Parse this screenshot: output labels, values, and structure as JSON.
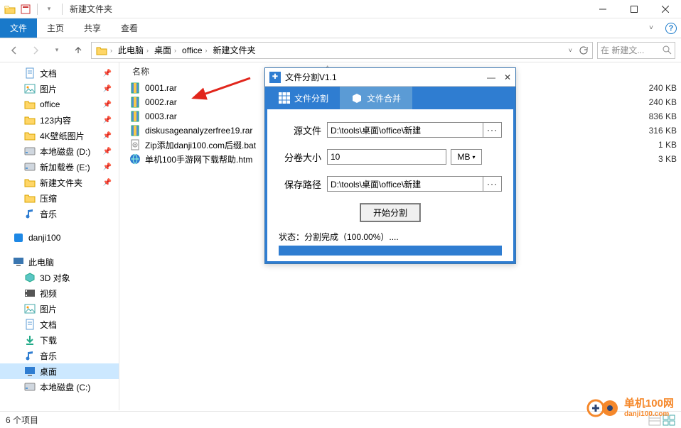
{
  "window": {
    "title": "新建文件夹"
  },
  "ribbon": {
    "file": "文件",
    "home": "主页",
    "share": "共享",
    "view": "查看"
  },
  "breadcrumb": {
    "segments": [
      "此电脑",
      "桌面",
      "office",
      "新建文件夹"
    ],
    "search_placeholder": "在 新建文..."
  },
  "columns": {
    "name": "名称"
  },
  "sidebar": {
    "quick": [
      {
        "label": "文档",
        "icon": "document",
        "pin": true
      },
      {
        "label": "图片",
        "icon": "picture",
        "pin": true
      },
      {
        "label": "office",
        "icon": "folder",
        "pin": true
      },
      {
        "label": "123内容",
        "icon": "folder",
        "pin": true
      },
      {
        "label": "4K壁纸图片",
        "icon": "folder",
        "pin": true
      },
      {
        "label": "本地磁盘 (D:)",
        "icon": "disk",
        "pin": true
      },
      {
        "label": "新加载卷 (E:)",
        "icon": "disk",
        "pin": true
      },
      {
        "label": "新建文件夹",
        "icon": "folder",
        "pin": true
      },
      {
        "label": "压缩",
        "icon": "folder",
        "pin": false
      },
      {
        "label": "音乐",
        "icon": "music",
        "pin": false
      }
    ],
    "danji": "danji100",
    "pc_label": "此电脑",
    "pc": [
      {
        "label": "3D 对象",
        "icon": "3d"
      },
      {
        "label": "视频",
        "icon": "video"
      },
      {
        "label": "图片",
        "icon": "picture"
      },
      {
        "label": "文档",
        "icon": "document"
      },
      {
        "label": "下载",
        "icon": "download"
      },
      {
        "label": "音乐",
        "icon": "music"
      },
      {
        "label": "桌面",
        "icon": "desktop",
        "sel": true
      },
      {
        "label": "本地磁盘 (C:)",
        "icon": "disk"
      }
    ]
  },
  "files": [
    {
      "name": "0001.rar",
      "icon": "rar",
      "size": "240 KB"
    },
    {
      "name": "0002.rar",
      "icon": "rar",
      "size": "240 KB"
    },
    {
      "name": "0003.rar",
      "icon": "rar",
      "size": "836 KB"
    },
    {
      "name": "diskusageanalyzerfree19.rar",
      "icon": "rar",
      "size": "316 KB"
    },
    {
      "name": "Zip添加danji100.com后缀.bat",
      "icon": "bat",
      "size": "1 KB"
    },
    {
      "name": "单机100手游网下载帮助.htm",
      "icon": "htm",
      "size": "3 KB"
    }
  ],
  "status": {
    "count": "6 个项目"
  },
  "dialog": {
    "title": "文件分割V1.1",
    "tab_split": "文件分割",
    "tab_merge": "文件合并",
    "label_source": "源文件",
    "value_source": "D:\\tools\\桌面\\office\\新建",
    "label_size": "分卷大小",
    "value_size": "10",
    "unit": "MB",
    "label_save": "保存路径",
    "value_save": "D:\\tools\\桌面\\office\\新建",
    "btn_start": "开始分割",
    "status": "状态：分割完成（100.00%）...."
  },
  "watermark": {
    "name": "单机100网",
    "url": "danji100.com"
  }
}
